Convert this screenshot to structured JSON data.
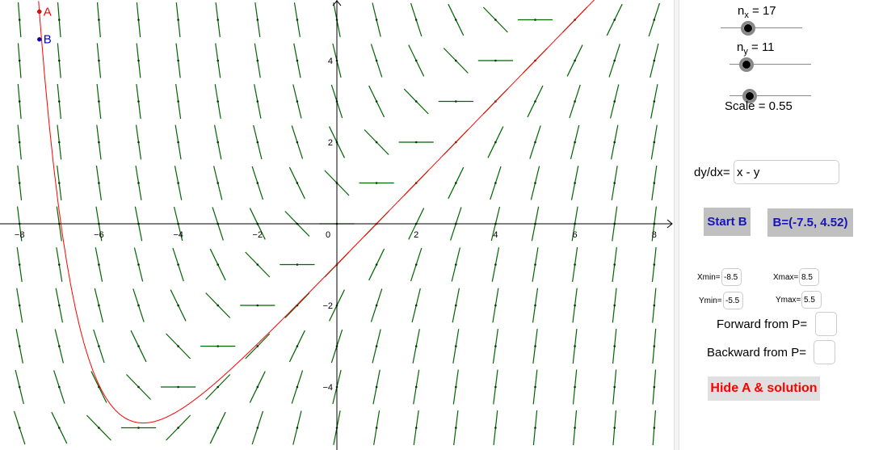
{
  "graphics": {
    "x_axis_ticks": [
      "−8",
      "−6",
      "−4",
      "−2",
      "0",
      "2",
      "4",
      "6",
      "8"
    ],
    "y_axis_ticks": [
      "4",
      "2",
      "−2",
      "−4"
    ],
    "x_range": [
      -8.5,
      8.5
    ],
    "y_range": [
      -5.5,
      5.5
    ],
    "slope_field": {
      "equation": "x - y",
      "nx": 17,
      "ny": 11,
      "scale": 0.55,
      "color": "#006400"
    },
    "solution_curve": {
      "color": "#ff0000",
      "through": [
        -7.5,
        5.2
      ]
    },
    "points": [
      {
        "name": "A",
        "x": -7.5,
        "y": 5.2,
        "color": "#ff0000"
      },
      {
        "name": "B",
        "x": -7.5,
        "y": 4.52,
        "color": "#0000cc"
      }
    ]
  },
  "panel": {
    "nx_label": "n",
    "nx_sub": "x",
    "nx_value": " = 17",
    "ny_label": "n",
    "ny_sub": "y",
    "ny_value": " = 11",
    "scale_label": "Scale = 0.55",
    "sliders": {
      "nx_fraction": 0.23,
      "ny_fraction": 0.2,
      "scale_fraction": 0.24
    },
    "dydx_label": "dy/dx=",
    "dydx_value": "x - y",
    "start_b_label": "Start B",
    "b_coords_label": "B=(-7.5, 4.52)",
    "xmin_label": "Xmin=",
    "xmin_value": "-8.5",
    "xmax_label": "Xmax=",
    "xmax_value": "8.5",
    "ymin_label": "Ymin=",
    "ymin_value": "-5.5",
    "ymax_label": "Ymax=",
    "ymax_value": "5.5",
    "forward_label": "Forward from P=",
    "forward_value": "",
    "backward_label": "Backward from P=",
    "backward_value": "",
    "hide_label": "Hide A & solution"
  }
}
